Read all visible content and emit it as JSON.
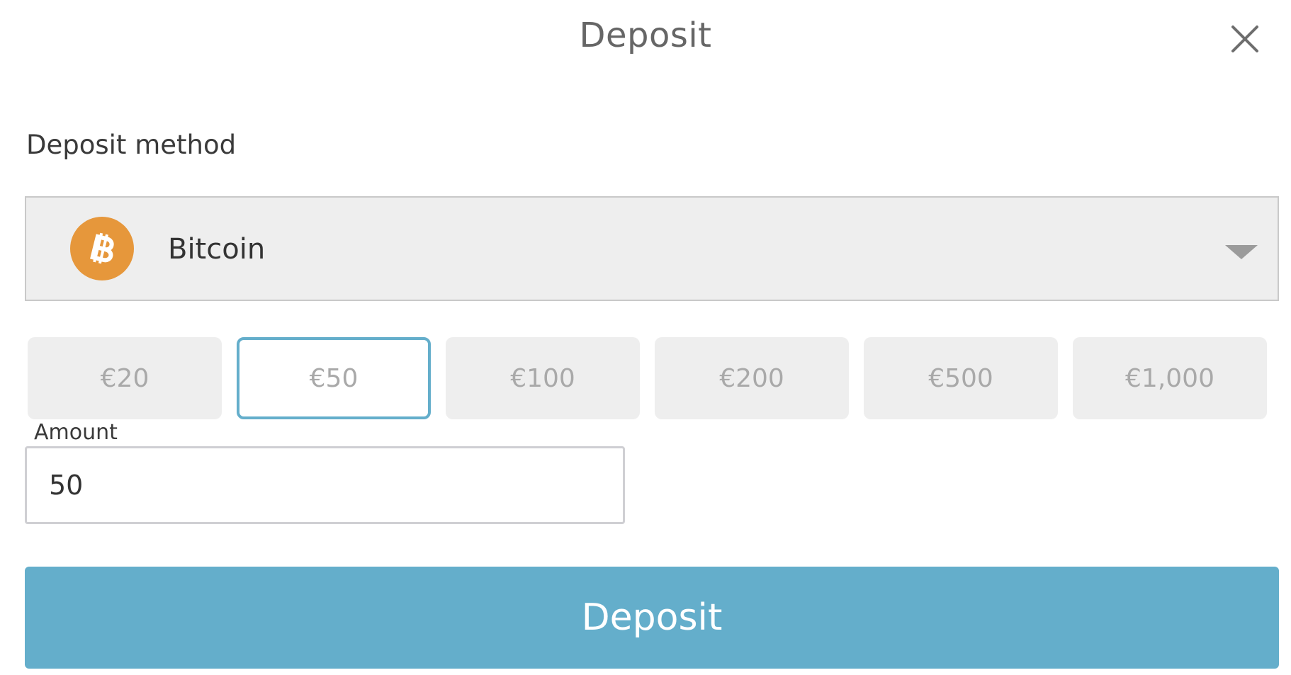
{
  "modal": {
    "title": "Deposit",
    "close_icon": "close-icon"
  },
  "deposit_method": {
    "label": "Deposit method",
    "selected": "Bitcoin",
    "icon": "bitcoin-icon",
    "icon_color": "#e6973b",
    "dropdown_icon": "chevron-down-icon"
  },
  "presets": {
    "options": [
      "€20",
      "€50",
      "€100",
      "€200",
      "€500",
      "€1,000"
    ],
    "selected": "€50"
  },
  "amount": {
    "label": "Amount",
    "value": "50"
  },
  "submit": {
    "label": "Deposit"
  },
  "colors": {
    "accent": "#64aecb",
    "muted_text": "#a9a9a9",
    "field_background": "#eeeeee"
  }
}
